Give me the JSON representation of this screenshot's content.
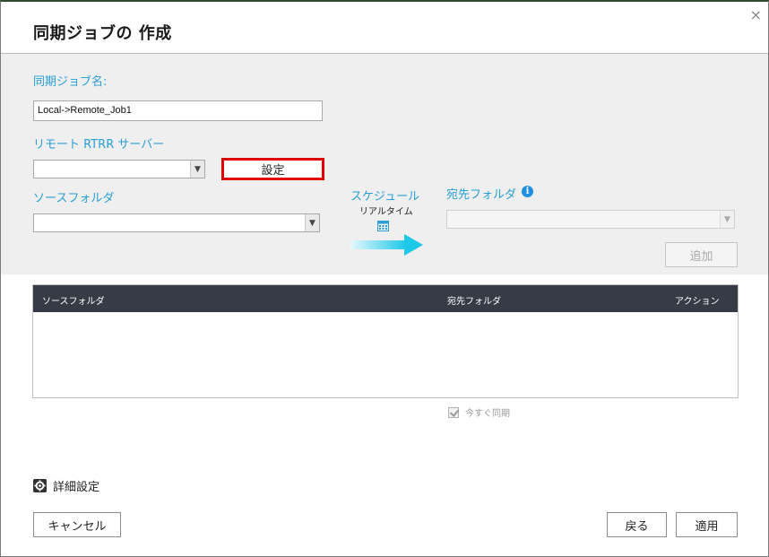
{
  "dialog": {
    "title": "同期ジョブの 作成",
    "close_glyph": "×"
  },
  "form": {
    "job_name_label": "同期ジョブ名:",
    "job_name_value": "Local->Remote_Job1",
    "remote_server_label": "リモート RTRR サーバー",
    "settings_button": "設定",
    "source_folder_label": "ソースフォルダ",
    "schedule_label": "スケジュール",
    "schedule_value": "リアルタイム",
    "dest_folder_label": "宛先フォルダ",
    "info_glyph": "i",
    "add_button": "追加"
  },
  "table": {
    "columns": [
      "ソースフォルダ",
      "宛先フォルダ",
      "アクション"
    ],
    "rows": []
  },
  "sync_now_label": "今すぐ同期",
  "advanced_settings_label": "詳細設定",
  "footer": {
    "cancel_button": "キャンセル",
    "back_button": "戻る",
    "apply_button": "適用"
  },
  "colors": {
    "accent_blue": "#2a9fd6",
    "table_header": "#363b45",
    "highlight_red": "#e00000",
    "arrow_cyan": "#1ec8e8"
  }
}
